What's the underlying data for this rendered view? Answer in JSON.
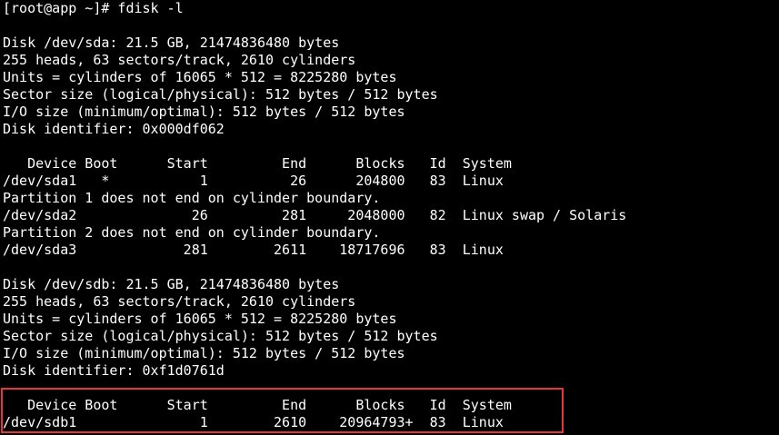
{
  "terminal": {
    "background": "#000000",
    "foreground": "#ffffff",
    "highlight_color": "#e0383b",
    "lines": [
      "[root@app ~]# fdisk -l",
      "",
      "Disk /dev/sda: 21.5 GB, 21474836480 bytes",
      "255 heads, 63 sectors/track, 2610 cylinders",
      "Units = cylinders of 16065 * 512 = 8225280 bytes",
      "Sector size (logical/physical): 512 bytes / 512 bytes",
      "I/O size (minimum/optimal): 512 bytes / 512 bytes",
      "Disk identifier: 0x000df062",
      "",
      "   Device Boot      Start         End      Blocks   Id  System",
      "/dev/sda1   *           1          26      204800   83  Linux",
      "Partition 1 does not end on cylinder boundary.",
      "/dev/sda2              26         281     2048000   82  Linux swap / Solaris",
      "Partition 2 does not end on cylinder boundary.",
      "/dev/sda3             281        2611    18717696   83  Linux",
      "",
      "Disk /dev/sdb: 21.5 GB, 21474836480 bytes",
      "255 heads, 63 sectors/track, 2610 cylinders",
      "Units = cylinders of 16065 * 512 = 8225280 bytes",
      "Sector size (logical/physical): 512 bytes / 512 bytes",
      "I/O size (minimum/optimal): 512 bytes / 512 bytes",
      "Disk identifier: 0xf1d0761d",
      "",
      "   Device Boot      Start         End      Blocks   Id  System",
      "/dev/sdb1               1        2610    20964793+  83  Linux"
    ]
  }
}
